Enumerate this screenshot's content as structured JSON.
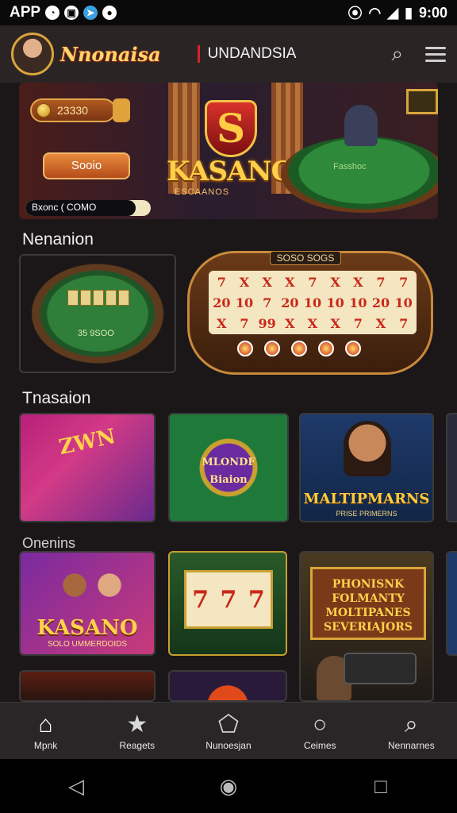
{
  "status_bar": {
    "left_text": "APP",
    "time": "9:00"
  },
  "top_bar": {
    "brand": "Nnonaisa",
    "section": "UNDANDSIA"
  },
  "banner": {
    "balance": "23330",
    "cta": "Sooio",
    "logo_letter": "S",
    "logo": "KASANO",
    "logo_sub": "ESCAANOS",
    "table_label": "Fasshoc",
    "progress": {
      "label": "Bxonc ( COMO",
      "value": 0.88
    }
  },
  "sections": {
    "first": "Nenanion",
    "second": "Tnasaion",
    "third": "Onenins"
  },
  "featured": {
    "slot_title": "SOSO SOGS",
    "table_num": "35 9SOO",
    "reel_symbols": [
      "7",
      "X",
      "X",
      "X",
      "7",
      "X",
      "X",
      "7",
      "7",
      "20",
      "10",
      "7",
      "20",
      "10",
      "10",
      "10",
      "20",
      "10",
      "X",
      "7",
      "99",
      "X",
      "X",
      "X",
      "7",
      "X",
      "7"
    ]
  },
  "games": {
    "g1": "ZWN",
    "g2": {
      "line1": "MLONDF",
      "line2": "Biaion"
    },
    "g3": {
      "title": "MALTIPMARNS",
      "sub": "PRISE PRIMERNS"
    },
    "g4": {
      "title": "KASANO",
      "sub": "SOLO UMMERDOIDS"
    },
    "g5": {
      "reels": [
        "7",
        "7",
        "7"
      ]
    },
    "g6": {
      "line1": "PHONISNK",
      "line2": "FOLMANTY",
      "line3": "MOLTIPANES",
      "line4": "SEVERIAJORS"
    }
  },
  "bottom_nav": [
    {
      "label": "Mpnk",
      "icon": "home-icon"
    },
    {
      "label": "Reagets",
      "icon": "star-icon"
    },
    {
      "label": "Nunoesjan",
      "icon": "house-outline-icon"
    },
    {
      "label": "Ceimes",
      "icon": "circle-icon"
    },
    {
      "label": "Nennarnes",
      "icon": "search-icon"
    }
  ],
  "colors": {
    "accent": "#d8222a",
    "gold": "#ffcf4a",
    "bg": "#1b1718"
  }
}
